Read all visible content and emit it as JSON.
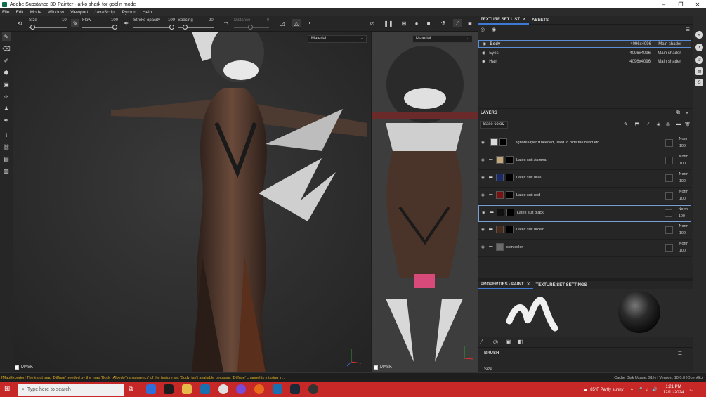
{
  "window": {
    "title": "Adobe Substance 3D Painter - arko shark for goblin mode",
    "min": "–",
    "max": "❐",
    "close": "✕"
  },
  "menu": [
    "File",
    "Edit",
    "Mode",
    "Window",
    "Viewport",
    "JavaScript",
    "Python",
    "Help"
  ],
  "toolbar": {
    "size_label": "Size",
    "size_value": "10",
    "size_level": 0.1,
    "flow_label": "Flow",
    "flow_value": "100",
    "flow_level": 1.0,
    "stroke_label": "Stroke opacity",
    "stroke_value": "100",
    "stroke_level": 1.0,
    "spacing_label": "Spacing",
    "spacing_value": "20",
    "spacing_level": 0.2,
    "distance_label": "Distance",
    "distance_value": "0"
  },
  "viewport3d": {
    "mode": "Material",
    "mask_label": "MASK"
  },
  "viewport2d": {
    "mode": "Material",
    "mask_label": "MASK"
  },
  "texture_set": {
    "tabs": [
      "TEXTURE SET LIST",
      "ASSETS"
    ],
    "rows": [
      {
        "name": "Body",
        "res": "4096x4096",
        "shader": "Main shader"
      },
      {
        "name": "Eyes",
        "res": "4096x4096",
        "shader": "Main shader"
      },
      {
        "name": "Hair",
        "res": "4096x4096",
        "shader": "Main shader"
      }
    ]
  },
  "layers": {
    "title": "LAYERS",
    "channel": "Base color",
    "items": [
      {
        "name": "Ignore layer if needed, used to hide the head etc",
        "blend": "Norm",
        "opacity": "100",
        "color": "#d9d9d9"
      },
      {
        "name": "Latex suit Aurona",
        "blend": "Norm",
        "opacity": "100",
        "color": "#c2a77a"
      },
      {
        "name": "Latex suit blue",
        "blend": "Norm",
        "opacity": "100",
        "color": "#1b2a6b"
      },
      {
        "name": "Latex suit red",
        "blend": "Norm",
        "opacity": "100",
        "color": "#7a1010"
      },
      {
        "name": "Latex suit black",
        "blend": "Norm",
        "opacity": "100",
        "color": "#111111"
      },
      {
        "name": "Latex suit brown",
        "blend": "Norm",
        "opacity": "100",
        "color": "#4a2a1a"
      },
      {
        "name": "skin color",
        "blend": "Norm",
        "opacity": "100",
        "color": "#6b6b6b"
      }
    ]
  },
  "properties": {
    "tabs": [
      "PROPERTIES - PAINT",
      "TEXTURE SET SETTINGS"
    ],
    "brush_label": "BRUSH",
    "size_label": "Size"
  },
  "status": {
    "message": "[MapExporter] The input map 'Diffuse' needed by the map 'Body_AlbedoTransparency' of the texture set 'Body' isn't available because: 'Diffuse' channel is missing in...",
    "right": "Cache Disk Usage:   91%  |  Version: 10.0.0 (OpenGL)"
  },
  "taskbar": {
    "search_placeholder": "Type here to search",
    "weather": "85°F  Partly sunny",
    "time": "1:21 PM",
    "date": "12/11/2024"
  }
}
